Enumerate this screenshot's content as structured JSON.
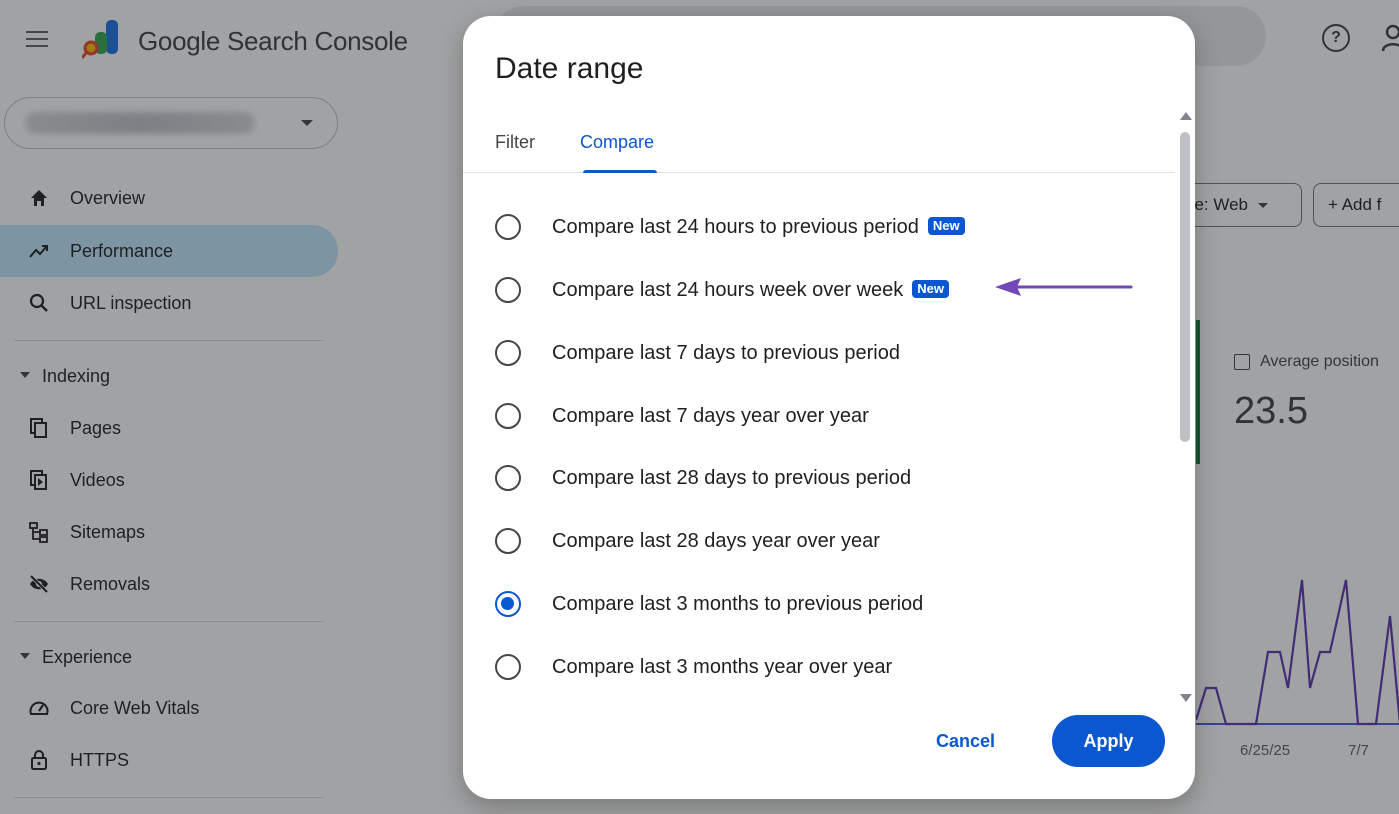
{
  "app": {
    "product_name": "Google Search Console"
  },
  "sidebar": {
    "items_top": [
      {
        "label": "Overview",
        "icon": "home-icon"
      },
      {
        "label": "Performance",
        "icon": "trending-up-icon",
        "active": true
      },
      {
        "label": "URL inspection",
        "icon": "search-icon"
      }
    ],
    "section_indexing": "Indexing",
    "items_indexing": [
      {
        "label": "Pages",
        "icon": "pages-icon"
      },
      {
        "label": "Videos",
        "icon": "video-icon"
      },
      {
        "label": "Sitemaps",
        "icon": "sitemap-icon"
      },
      {
        "label": "Removals",
        "icon": "eye-off-icon"
      }
    ],
    "section_experience": "Experience",
    "items_experience": [
      {
        "label": "Core Web Vitals",
        "icon": "speed-icon"
      },
      {
        "label": "HTTPS",
        "icon": "lock-icon"
      }
    ]
  },
  "main": {
    "search_type_chip": "pe: Web",
    "add_filter_chip": "+ Add f",
    "metric": {
      "name": "Average position",
      "value": "23.5"
    },
    "chart_dates": [
      "6/25/25",
      "7/7"
    ]
  },
  "dialog": {
    "title": "Date range",
    "tabs": [
      {
        "label": "Filter",
        "active": false
      },
      {
        "label": "Compare",
        "active": true
      }
    ],
    "badge_new": "New",
    "options": [
      {
        "label": "Compare last 24 hours to previous period",
        "new": true,
        "checked": false
      },
      {
        "label": "Compare last 24 hours week over week",
        "new": true,
        "checked": false
      },
      {
        "label": "Compare last 7 days to previous period",
        "new": false,
        "checked": false
      },
      {
        "label": "Compare last 7 days year over year",
        "new": false,
        "checked": false
      },
      {
        "label": "Compare last 28 days to previous period",
        "new": false,
        "checked": false
      },
      {
        "label": "Compare last 28 days year over year",
        "new": false,
        "checked": false
      },
      {
        "label": "Compare last 3 months to previous period",
        "new": false,
        "checked": true
      },
      {
        "label": "Compare last 3 months year over year",
        "new": false,
        "checked": false
      }
    ],
    "cancel_label": "Cancel",
    "apply_label": "Apply"
  },
  "colors": {
    "accent": "#0b57d0",
    "annotation_arrow": "#7248b9",
    "active_nav": "#c2e7ff",
    "chart_line": "#5e35b1"
  }
}
